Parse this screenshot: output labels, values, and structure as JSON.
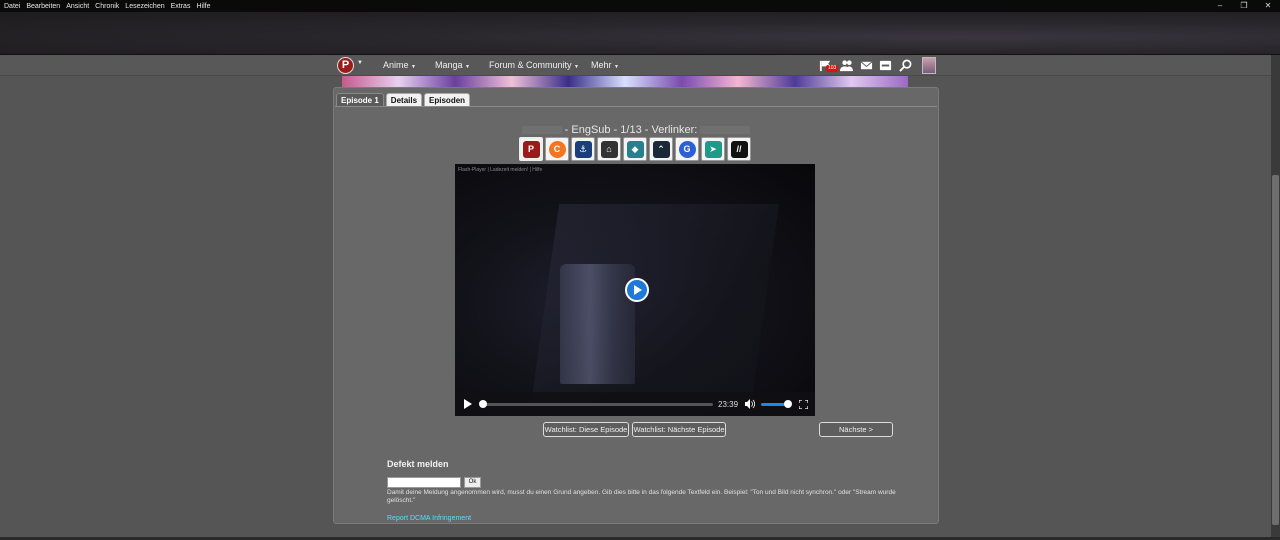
{
  "browser_menu": [
    "Datei",
    "Bearbeiten",
    "Ansicht",
    "Chronik",
    "Lesezeichen",
    "Extras",
    "Hilfe"
  ],
  "window_controls": {
    "minimize": "–",
    "restore": "❐",
    "close": "✕"
  },
  "nav": {
    "logo_text": "P",
    "items": [
      "Anime",
      "Manga",
      "Forum & Community",
      "Mehr"
    ],
    "notification_count": "103"
  },
  "tabs": [
    "Episode 1",
    "Details",
    "Episoden"
  ],
  "stream_title": "- EngSub - 1/13 - Verlinker:",
  "hosters": [
    {
      "icon": "proxer-icon",
      "color": "#9b1b1b",
      "label": "P"
    },
    {
      "icon": "crunchyroll-icon",
      "color": "#f47521",
      "label": "C"
    },
    {
      "icon": "streamcloud-icon",
      "color": "#1a3f7a",
      "label": "⚓"
    },
    {
      "icon": "archive-icon",
      "color": "#333333",
      "label": "⌂"
    },
    {
      "icon": "mp4upload-icon",
      "color": "#2a7f8f",
      "label": "◆"
    },
    {
      "icon": "steam-icon",
      "color": "#1b2838",
      "label": "⌃"
    },
    {
      "icon": "gog-icon",
      "color": "#2d5fd4",
      "label": "G"
    },
    {
      "icon": "streamango-icon",
      "color": "#1d9a8a",
      "label": "➤"
    },
    {
      "icon": "vidoza-icon",
      "color": "#111111",
      "label": "//"
    }
  ],
  "player": {
    "top_links": "Flash-Player | Ladezeit melden! | Hilfe",
    "time": "23:39",
    "progress": 0.0,
    "volume": 1.0
  },
  "buttons": {
    "watchlist_current": "Watchlist: Diese Episode",
    "watchlist_next": "Watchlist: Nächste Episode",
    "next": "Nächste >"
  },
  "report": {
    "title": "Defekt melden",
    "ok": "Ok",
    "hint": "Damit deine Meldung angenommen wird, musst du einen Grund angeben. Gib dies bitte in das folgende Textfeld ein. Beispiel: \"Ton und Bild nicht synchron.\" oder \"Stream wurde gelöscht.\"",
    "dmca": "Report DCMA Infringement"
  }
}
